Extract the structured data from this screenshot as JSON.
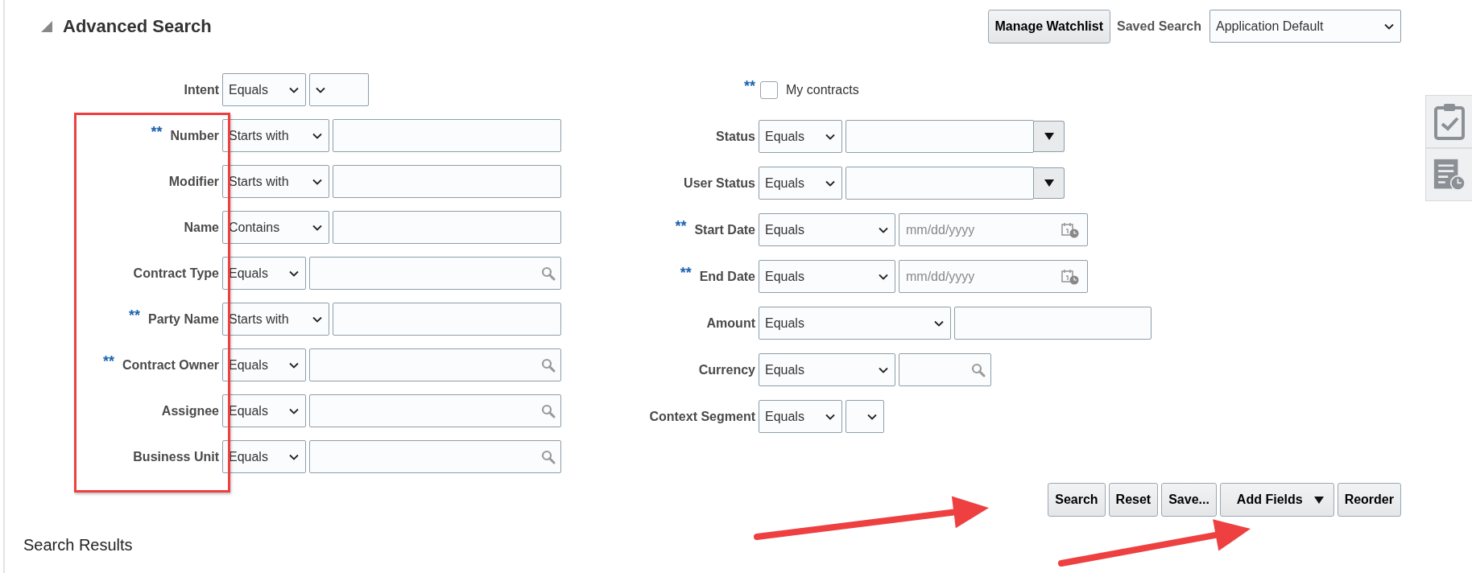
{
  "header": {
    "title": "Advanced Search",
    "expanded": true,
    "manage_button": "Manage Watchlist",
    "saved_search_label": "Saved Search",
    "saved_search_value": "Application Default"
  },
  "left_fields": [
    {
      "label": "Intent",
      "operator": "Equals",
      "value": {
        "kind": "select"
      }
    },
    {
      "label": "Number",
      "marker": "**",
      "operator": "Starts with",
      "value": {
        "kind": "text"
      }
    },
    {
      "label": "Modifier",
      "operator": "Starts with",
      "value": {
        "kind": "text"
      }
    },
    {
      "label": "Name",
      "operator": "Contains",
      "value": {
        "kind": "text"
      }
    },
    {
      "label": "Contract Type",
      "operator": "Equals",
      "value": {
        "kind": "lookup"
      }
    },
    {
      "label": "Party Name",
      "marker": "**",
      "operator": "Starts with",
      "value": {
        "kind": "text"
      }
    },
    {
      "label": "Contract Owner",
      "marker": "**",
      "operator": "Equals",
      "value": {
        "kind": "lookup"
      }
    },
    {
      "label": "Assignee",
      "operator": "Equals",
      "value": {
        "kind": "lookup"
      }
    },
    {
      "label": "Business Unit",
      "operator": "Equals",
      "value": {
        "kind": "lookup"
      }
    }
  ],
  "right_fields": [
    {
      "kind": "checkbox",
      "marker": "**",
      "label": "My contracts",
      "checked": false
    },
    {
      "kind": "field",
      "label": "Status",
      "operator": "Equals",
      "value": {
        "kind": "list"
      }
    },
    {
      "kind": "field",
      "label": "User Status",
      "operator": "Equals",
      "value": {
        "kind": "list"
      }
    },
    {
      "kind": "field",
      "label": "Start Date",
      "marker": "**",
      "operator": "Equals",
      "value": {
        "kind": "date",
        "placeholder": "mm/dd/yyyy"
      }
    },
    {
      "kind": "field",
      "label": "End Date",
      "marker": "**",
      "operator": "Equals",
      "value": {
        "kind": "date",
        "placeholder": "mm/dd/yyyy"
      }
    },
    {
      "kind": "field",
      "label": "Amount",
      "operator": "Equals",
      "value": {
        "kind": "text"
      }
    },
    {
      "kind": "field",
      "label": "Currency",
      "operator": "Equals",
      "value": {
        "kind": "lookup"
      }
    },
    {
      "kind": "field",
      "label": "Context Segment",
      "operator": "Equals",
      "value": {
        "kind": "select"
      }
    }
  ],
  "actions": [
    {
      "label": "Search",
      "kind": "plain"
    },
    {
      "label": "Reset",
      "kind": "plain"
    },
    {
      "label": "Save...",
      "kind": "plain"
    },
    {
      "label": "Add Fields",
      "kind": "menu"
    },
    {
      "label": "Reorder",
      "kind": "plain"
    }
  ],
  "results_title": "Search Results",
  "side_tray": [
    {
      "kind": "clipboard"
    },
    {
      "kind": "report"
    }
  ],
  "annotations": [
    {
      "kind": "box"
    },
    {
      "kind": "arrow"
    },
    {
      "kind": "arrow"
    }
  ]
}
